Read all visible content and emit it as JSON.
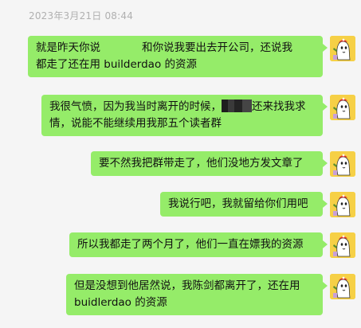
{
  "timestamp": "2023年3月21日 08:44",
  "messages": [
    {
      "lines": [
        "就是昨天你说",
        "和你说我要出去开公司，还说我",
        "都走了还在用 builderdao 的资源"
      ]
    },
    {
      "lines": [
        "我很气愤，因为我当时离开的时候，",
        "还来找我求",
        "情，说能不能继续用我那五个读者群"
      ]
    },
    {
      "lines": [
        "要不然我把群带走了，他们没地方发文章了"
      ]
    },
    {
      "lines": [
        "我说行吧，我就留给你们用吧"
      ]
    },
    {
      "lines": [
        "所以我都走了两个月了，他们一直在嫖我的资源"
      ]
    },
    {
      "lines": [
        "但是没想到他居然说，我陈剑都离开了，还在用",
        "buidlerdao 的资源"
      ]
    }
  ],
  "avatar": {
    "icon": "ghost-sticker-avatar",
    "bg": "#f6d046"
  },
  "colors": {
    "bubble": "#95ec69",
    "background": "#f5f5f5"
  }
}
